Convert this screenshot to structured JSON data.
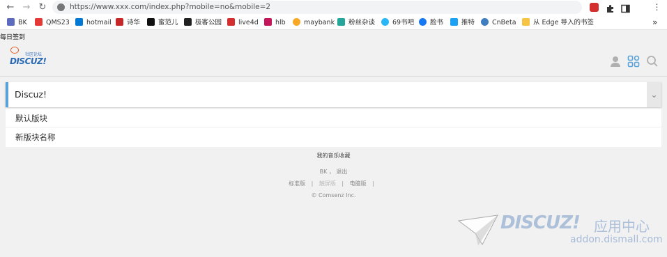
{
  "browser": {
    "url": "https://www.xxx.com/index.php?mobile=no&mobile=2",
    "bookmarks": [
      {
        "label": "BK",
        "color": "#5c6bc0"
      },
      {
        "label": "QMS23",
        "color": "#e53935"
      },
      {
        "label": "hotmail",
        "color": "#0078d4"
      },
      {
        "label": "诗华",
        "color": "#c62828"
      },
      {
        "label": "蜜范儿",
        "color": "#111111"
      },
      {
        "label": "极客公园",
        "color": "#222222"
      },
      {
        "label": "live4d",
        "color": "#d32f2f"
      },
      {
        "label": "hlb",
        "color": "#c2185b"
      },
      {
        "label": "maybank",
        "color": "#f9a825"
      },
      {
        "label": "粉丝杂谈",
        "color": "#26a69a"
      },
      {
        "label": "69书吧",
        "color": "#29b6f6"
      },
      {
        "label": "脸书",
        "color": "#1877f2"
      },
      {
        "label": "推特",
        "color": "#1da1f2"
      },
      {
        "label": "CnBeta",
        "color": "#3f7cc0"
      },
      {
        "label": "从 Edge 导入的书签",
        "color": "#f6c343"
      }
    ],
    "more": "»"
  },
  "page": {
    "signin": "每日签到",
    "logo_text": "DISCUZ!",
    "logo_sub": "社区论坛",
    "forum_title": "Discuz!",
    "sub_forums": [
      "默认版块",
      "新版块名称"
    ],
    "footer": {
      "favorites": "我的音乐收藏",
      "user": "BK",
      "comma": "，",
      "logout": "退出",
      "links": [
        "标准版",
        "触屏版",
        "电脑版"
      ],
      "pipe": "|",
      "copyright": "© Comsenz Inc."
    },
    "watermark": {
      "brand": "DISCUZ!",
      "brand_cn": "应用中心",
      "url": "addon.dismall.com"
    }
  },
  "colors": {
    "accent": "#5aa3d9",
    "logo_blue": "#2b6ab5"
  }
}
